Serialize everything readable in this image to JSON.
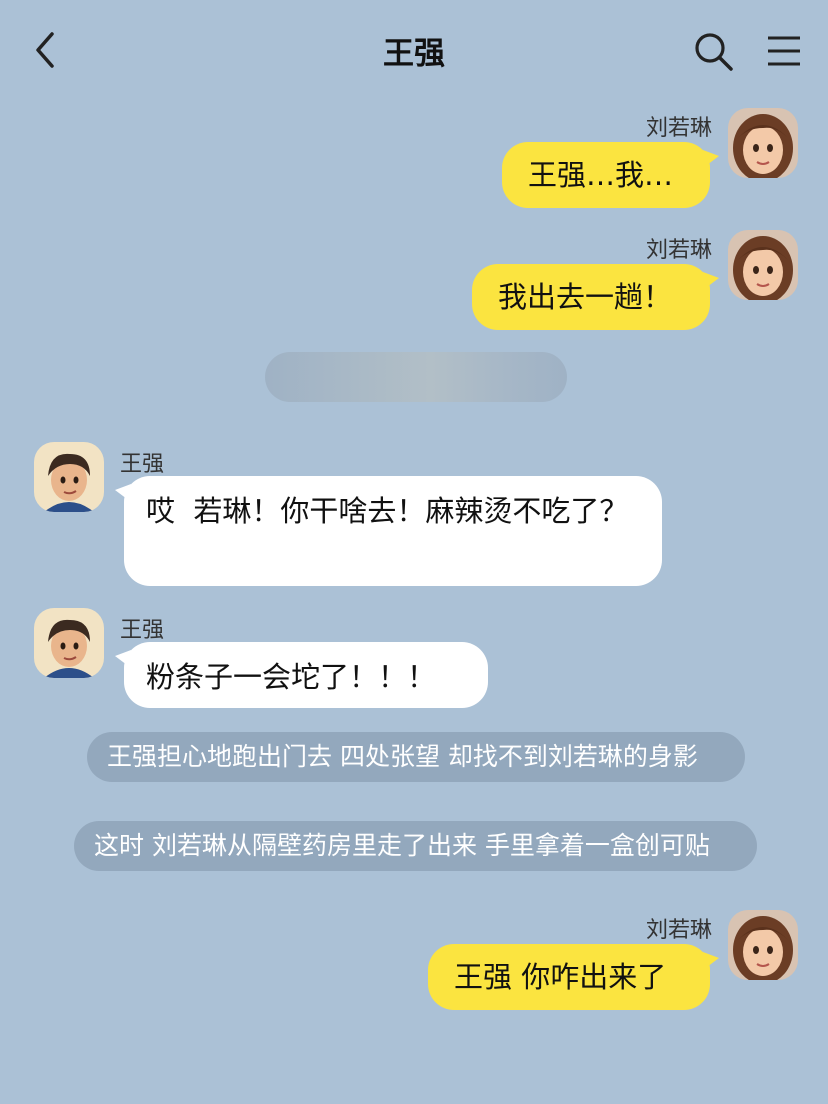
{
  "header": {
    "title": "王强",
    "back_icon": "chevron-left-icon",
    "search_icon": "search-icon",
    "menu_icon": "hamburger-menu-icon"
  },
  "colors": {
    "background": "#abc1d6",
    "my_bubble": "#fbe440",
    "their_bubble": "#ffffff",
    "narration_pill": "#93a8bd"
  },
  "messages": [
    {
      "type": "sent",
      "sender": "刘若琳",
      "text": "王强…我…"
    },
    {
      "type": "sent",
      "sender": "刘若琳",
      "text": "我出去一趟！"
    },
    {
      "type": "received",
      "sender": "王强",
      "text": "哎  若琳！你干啥去！麻辣烫不吃了？"
    },
    {
      "type": "received",
      "sender": "王强",
      "text": "粉条子一会坨了！！！"
    },
    {
      "type": "narration",
      "text": "王强担心地跑出门去 四处张望 却找不到刘若琳的身影"
    },
    {
      "type": "narration",
      "text": "这时 刘若琳从隔壁药房里走了出来 手里拿着一盒创可贴"
    },
    {
      "type": "sent",
      "sender": "刘若琳",
      "text": "王强 你咋出来了"
    }
  ]
}
